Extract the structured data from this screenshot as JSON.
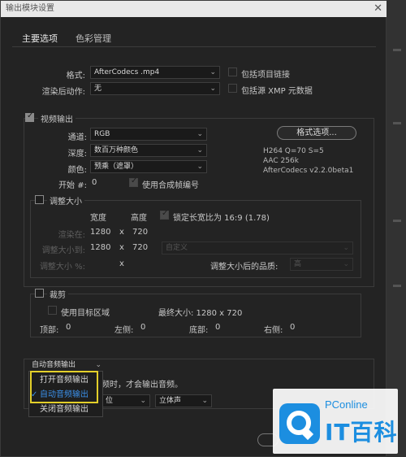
{
  "window": {
    "title": "输出模块设置",
    "close_glyph": "✕"
  },
  "tabs": [
    {
      "label": "主要选项",
      "active": true
    },
    {
      "label": "色彩管理",
      "active": false
    }
  ],
  "format": {
    "label": "格式:",
    "value": "AfterCodecs .mp4",
    "include_project_link": "包括项目链接"
  },
  "post_render": {
    "label": "渲染后动作:",
    "value": "无",
    "include_xmp": "包括源 XMP 元数据"
  },
  "video_output": {
    "label": "视频输出",
    "checked": true,
    "channels": {
      "label": "通道:",
      "value": "RGB"
    },
    "depth": {
      "label": "深度:",
      "value": "数百万种颜色"
    },
    "color": {
      "label": "颜色:",
      "value": "预乘（遮罩）"
    },
    "start": {
      "label": "开始 #:",
      "value": "0",
      "use_comp_frame": "使用合成帧编号"
    },
    "format_options_button": "格式选项...",
    "codec_info": [
      "H264 Q=70 S=5",
      "AAC 256k",
      "AfterCodecs v2.2.0beta1"
    ]
  },
  "resize": {
    "label": "调整大小",
    "checked": false,
    "col_width": "宽度",
    "col_height": "高度",
    "lock_aspect": "锁定长宽比为 16:9 (1.78)",
    "render_at": {
      "label": "渲染在:",
      "w": "1280",
      "x": "x",
      "h": "720"
    },
    "resize_to": {
      "label": "调整大小到:",
      "w": "1280",
      "x": "x",
      "h": "720",
      "preset": "自定义"
    },
    "resize_pct": {
      "label": "调整大小 %:",
      "x": "x"
    },
    "quality": {
      "label": "调整大小后的品质:",
      "value": "高"
    }
  },
  "crop": {
    "label": "裁剪",
    "checked": false,
    "use_roi": "使用目标区域",
    "final_size": "最终大小: 1280 x 720",
    "top": {
      "label": "顶部:",
      "value": "0"
    },
    "left": {
      "label": "左侧:",
      "value": "0"
    },
    "bottom": {
      "label": "底部:",
      "value": "0"
    },
    "right": {
      "label": "右侧:",
      "value": "0"
    }
  },
  "audio": {
    "dropdown_value": "自动音频输出",
    "hint": "频时，才会输出音频。",
    "unit_fragment": "位",
    "channels_value": "立体声"
  },
  "audio_menu": [
    {
      "label": "打开音频输出",
      "selected": false
    },
    {
      "label": "自动音频输出",
      "selected": true,
      "tick": "✓"
    },
    {
      "label": "关闭音频输出",
      "selected": false
    }
  ],
  "watermark": {
    "small": "PConline",
    "big": "IT百科"
  }
}
